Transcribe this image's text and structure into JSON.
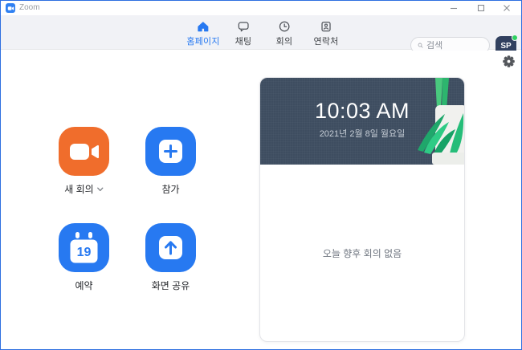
{
  "window": {
    "title": "Zoom",
    "controls": {
      "minimize": "minimize-icon",
      "maximize": "maximize-icon",
      "close": "close-icon"
    }
  },
  "nav": {
    "items": [
      {
        "label": "홈페이지",
        "icon": "home-icon",
        "active": true
      },
      {
        "label": "채팅",
        "icon": "chat-icon",
        "active": false
      },
      {
        "label": "회의",
        "icon": "clock-icon",
        "active": false
      },
      {
        "label": "연락처",
        "icon": "contacts-icon",
        "active": false
      }
    ],
    "search": {
      "placeholder": "검색",
      "icon": "search-icon"
    },
    "avatar": {
      "initials": "SP",
      "status": "online",
      "status_color": "#2ed160"
    }
  },
  "settings_icon": "gear-icon",
  "actions": [
    {
      "label": "새 회의",
      "icon": "video-camera-icon",
      "color": "#f06d2c",
      "has_dropdown": true
    },
    {
      "label": "참가",
      "icon": "plus-icon",
      "color": "#2779f1"
    },
    {
      "label": "예약",
      "icon": "calendar-icon",
      "color": "#2779f1",
      "calendar_day": "19"
    },
    {
      "label": "화면 공유",
      "icon": "share-screen-icon",
      "color": "#2779f1"
    }
  ],
  "meeting_panel": {
    "time": "10:03 AM",
    "date": "2021년 2월 8일 월요일",
    "empty_message": "오늘 향후 회의 없음"
  },
  "colors": {
    "accent_blue": "#2779f1",
    "accent_orange": "#f06d2c",
    "panel_header": "#3e4d60",
    "nav_background": "#f1f2f6",
    "window_border": "#2e6fe0"
  }
}
